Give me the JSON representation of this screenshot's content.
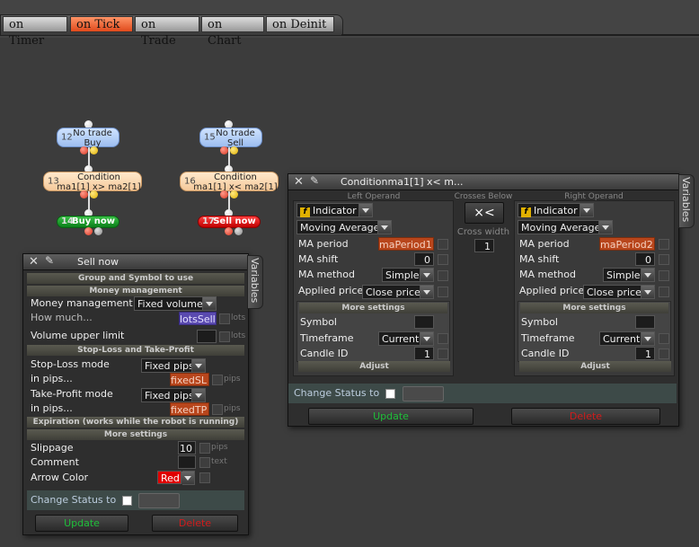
{
  "tabs": [
    {
      "label": "on Timer",
      "active": false
    },
    {
      "label": "on Tick",
      "active": true
    },
    {
      "label": "on Trade",
      "active": false
    },
    {
      "label": "on Chart",
      "active": false
    },
    {
      "label": "on Deinit",
      "active": false
    }
  ],
  "nodes": {
    "n12": {
      "num": "12",
      "line1": "No trade",
      "line2": "Buy"
    },
    "n13": {
      "num": "13",
      "line1": "Condition",
      "line2": "ma1[1] x> ma2[1]"
    },
    "n14": {
      "num": "14",
      "label": "Buy now"
    },
    "n15": {
      "num": "15",
      "line1": "No trade",
      "line2": "Sell"
    },
    "n16": {
      "num": "16",
      "line1": "Condition",
      "line2": "ma1[1] x< ma2[1]"
    },
    "n17": {
      "num": "17",
      "label": "Sell now"
    }
  },
  "sell_panel": {
    "title": "Sell now",
    "variables_tab": "Variables",
    "sec_group": "Group and Symbol to use",
    "sec_money": "Money management",
    "money_label": "Money management",
    "money_value": "Fixed volume",
    "howmuch_label": "How much...",
    "howmuch_value": "lotsSell",
    "howmuch_unit": "lots",
    "upper_label": "Volume upper limit",
    "upper_unit": "lots",
    "sec_sltp": "Stop-Loss and Take-Profit",
    "sl_label": "Stop-Loss mode",
    "sl_value": "Fixed pips",
    "sl_in_label": "in pips...",
    "sl_in_value": "fixedSL",
    "sl_unit": "pips",
    "tp_label": "Take-Profit mode",
    "tp_value": "Fixed pips",
    "tp_in_label": "in pips...",
    "tp_in_value": "fixedTP",
    "tp_unit": "pips",
    "sec_exp": "Expiration (works while the robot is running)",
    "sec_more": "More settings",
    "slip_label": "Slippage",
    "slip_value": "10",
    "slip_unit": "pips",
    "comment_label": "Comment",
    "comment_unit": "text",
    "arrow_label": "Arrow Color",
    "arrow_value": "Red",
    "status_label": "Change Status to",
    "update": "Update",
    "delete": "Delete"
  },
  "cond_panel": {
    "title": "Conditionma1[1] x< m...",
    "variables_tab": "Variables",
    "left_head": "Left Operand",
    "cross_head": "Crosses Below",
    "right_head": "Right Operand",
    "cross_symbol": "×<",
    "cross_width_label": "Cross width",
    "cross_width_value": "1",
    "left": {
      "type": "Indicator",
      "indicator": "Moving Average",
      "period_label": "MA period",
      "period_value": "maPeriod1",
      "shift_label": "MA shift",
      "shift_value": "0",
      "method_label": "MA method",
      "method_value": "Simple",
      "price_label": "Applied price",
      "price_value": "Close price",
      "more": "More settings",
      "symbol_label": "Symbol",
      "tf_label": "Timeframe",
      "tf_value": "Current",
      "candle_label": "Candle ID",
      "candle_value": "1",
      "adjust": "Adjust"
    },
    "right": {
      "type": "Indicator",
      "indicator": "Moving Average",
      "period_label": "MA period",
      "period_value": "maPeriod2",
      "shift_label": "MA shift",
      "shift_value": "0",
      "method_label": "MA method",
      "method_value": "Simple",
      "price_label": "Applied price",
      "price_value": "Close price",
      "more": "More settings",
      "symbol_label": "Symbol",
      "tf_label": "Timeframe",
      "tf_value": "Current",
      "candle_label": "Candle ID",
      "candle_value": "1",
      "adjust": "Adjust"
    },
    "status_label": "Change Status to",
    "update": "Update",
    "delete": "Delete"
  }
}
